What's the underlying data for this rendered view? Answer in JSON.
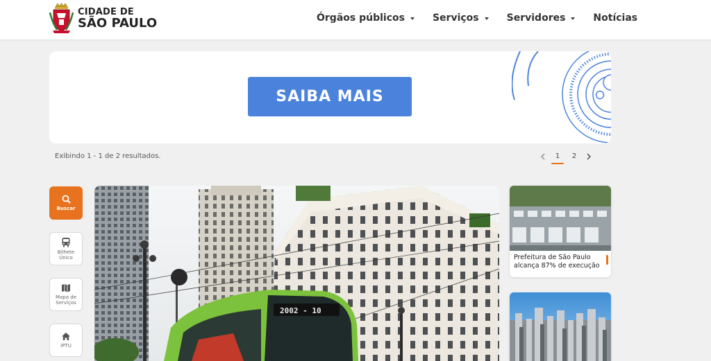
{
  "header": {
    "logo_line1": "CIDADE DE",
    "logo_line2": "SÃO PAULO",
    "nav": [
      {
        "label": "Órgãos públicos",
        "has_dropdown": true
      },
      {
        "label": "Serviços",
        "has_dropdown": true
      },
      {
        "label": "Servidores",
        "has_dropdown": true
      },
      {
        "label": "Notícias",
        "has_dropdown": false
      }
    ]
  },
  "banner": {
    "button_label": "SAIBA  MAIS"
  },
  "results": {
    "summary": "Exibindo 1 - 1 de 2 resultados.",
    "pages": [
      "1",
      "2"
    ],
    "current_page": "1"
  },
  "quick_links": [
    {
      "label": "Buscar",
      "icon": "search-icon"
    },
    {
      "label": "Bilhete Único",
      "icon": "bus-icon"
    },
    {
      "label": "Mapa de Serviços",
      "icon": "map-icon"
    },
    {
      "label": "IPTU",
      "icon": "home-icon"
    }
  ],
  "news": [
    {
      "title": "Prefeitura de São Paulo alcança 87% de execução"
    },
    {
      "title": ""
    }
  ],
  "colors": {
    "accent": "#e8731e",
    "banner_button": "#4a82dc",
    "bus_green": "#7cc23c"
  }
}
